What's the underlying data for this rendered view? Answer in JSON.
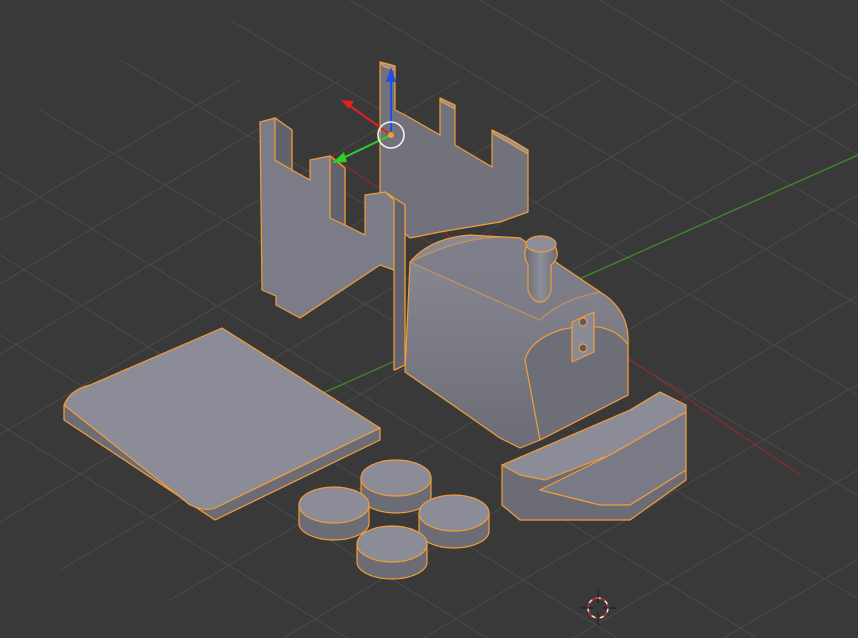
{
  "app": "3D Viewport",
  "colors": {
    "background": "#393939",
    "grid": "#4a4a4a",
    "x_axis": "#8a2a2a",
    "y_axis": "#3f8a2a",
    "gizmo_x": "#e0211d",
    "gizmo_y": "#2ad12a",
    "gizmo_z": "#1f4fe8",
    "selection_outline": "#f29d38",
    "mesh_top": "#8c8c98",
    "mesh_side": "#6e6e78",
    "mesh_dark": "#5c5c66"
  },
  "icons": {
    "cursor": "3d-cursor-icon",
    "pivot": "transform-pivot-icon"
  },
  "objects": [
    "castle-wall",
    "locomotive-body",
    "chimney",
    "cab-front",
    "base-plate",
    "wheel-1",
    "wheel-2",
    "wheel-3",
    "wheel-4"
  ]
}
